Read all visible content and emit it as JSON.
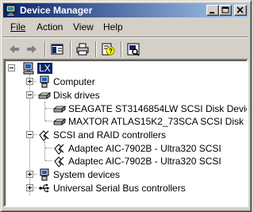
{
  "window": {
    "title": "Device Manager",
    "title_icon": "device-manager-icon",
    "caption_buttons": [
      "minimize",
      "maximize",
      "close"
    ]
  },
  "menu": {
    "file": "File",
    "action": "Action",
    "view": "View",
    "help": "Help"
  },
  "toolbar": {
    "icons": [
      "back-arrow-icon",
      "forward-arrow-icon",
      "show-hide-tree-icon",
      "print-icon",
      "properties-help-icon",
      "scan-hardware-icon"
    ]
  },
  "tree": {
    "root": {
      "label": "LX",
      "icon": "computer-icon"
    },
    "nodes": [
      {
        "label": "Computer",
        "icon": "computer-icon",
        "expanded": false
      },
      {
        "label": "Disk drives",
        "icon": "disk-drive-icon",
        "expanded": true,
        "children": [
          {
            "label": "SEAGATE ST3146854LW SCSI Disk Device",
            "icon": "disk-drive-icon"
          },
          {
            "label": "MAXTOR ATLAS15K2_73SCA SCSI Disk Device",
            "icon": "disk-drive-icon"
          }
        ]
      },
      {
        "label": "SCSI and RAID controllers",
        "icon": "scsi-controller-icon",
        "expanded": true,
        "children": [
          {
            "label": "Adaptec AIC-7902B - Ultra320 SCSI",
            "icon": "scsi-controller-icon"
          },
          {
            "label": "Adaptec AIC-7902B - Ultra320 SCSI",
            "icon": "scsi-controller-icon"
          }
        ]
      },
      {
        "label": "System devices",
        "icon": "system-devices-icon",
        "expanded": false
      },
      {
        "label": "Universal Serial Bus controllers",
        "icon": "usb-icon",
        "expanded": false
      }
    ]
  },
  "colors": {
    "titlebar_start": "#0a246a",
    "titlebar_end": "#a6caf0",
    "selection": "#0a246a",
    "face": "#d4d0c8"
  }
}
